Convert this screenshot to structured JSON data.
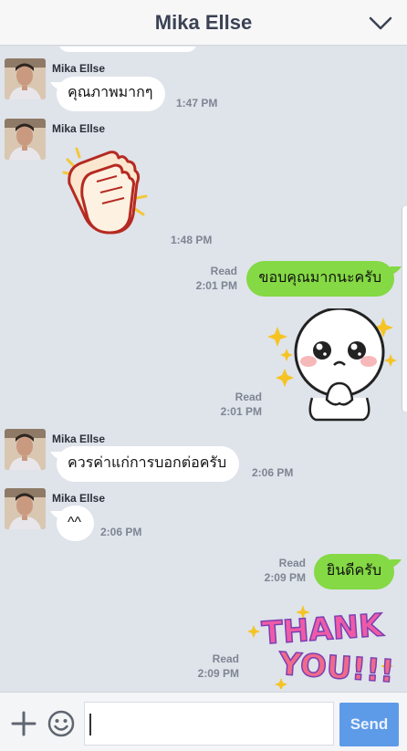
{
  "header": {
    "title": "Mika Ellse",
    "collapse_icon": "chevron-down-icon"
  },
  "messages": [
    {
      "type": "text",
      "direction": "in",
      "sender": "Mika Ellse",
      "text": "คุณภาพมากๆ",
      "time": "1:47 PM"
    },
    {
      "type": "sticker",
      "direction": "in",
      "sender": "Mika Ellse",
      "sticker": "clapping-hands-sticker",
      "time": "1:48 PM"
    },
    {
      "type": "text",
      "direction": "out",
      "read": "Read",
      "text": "ขอบคุณมากนะครับ",
      "time": "2:01 PM"
    },
    {
      "type": "sticker",
      "direction": "out",
      "read": "Read",
      "sticker": "moon-face-sticker",
      "time": "2:01 PM"
    },
    {
      "type": "text",
      "direction": "in",
      "sender": "Mika Ellse",
      "text": "ควรค่าแก่การบอกต่อครับ",
      "time": "2:06 PM"
    },
    {
      "type": "text",
      "direction": "in",
      "sender": "Mika Ellse",
      "text": "^^",
      "time": "2:06 PM"
    },
    {
      "type": "text",
      "direction": "out",
      "read": "Read",
      "text": "ยินดีครับ",
      "time": "2:09 PM"
    },
    {
      "type": "sticker",
      "direction": "out",
      "read": "Read",
      "sticker": "thank-you-sticker",
      "sticker_text": [
        "THANK",
        "YOU!!!"
      ],
      "time": "2:09 PM"
    }
  ],
  "input": {
    "value": "",
    "send_label": "Send",
    "plus_icon": "plus-icon",
    "emoji_icon": "emoji-icon"
  },
  "colors": {
    "outgoing_bubble": "#84d944",
    "incoming_bubble": "#ffffff",
    "background": "#dfe3ea",
    "send_button": "#5d9ae8"
  }
}
